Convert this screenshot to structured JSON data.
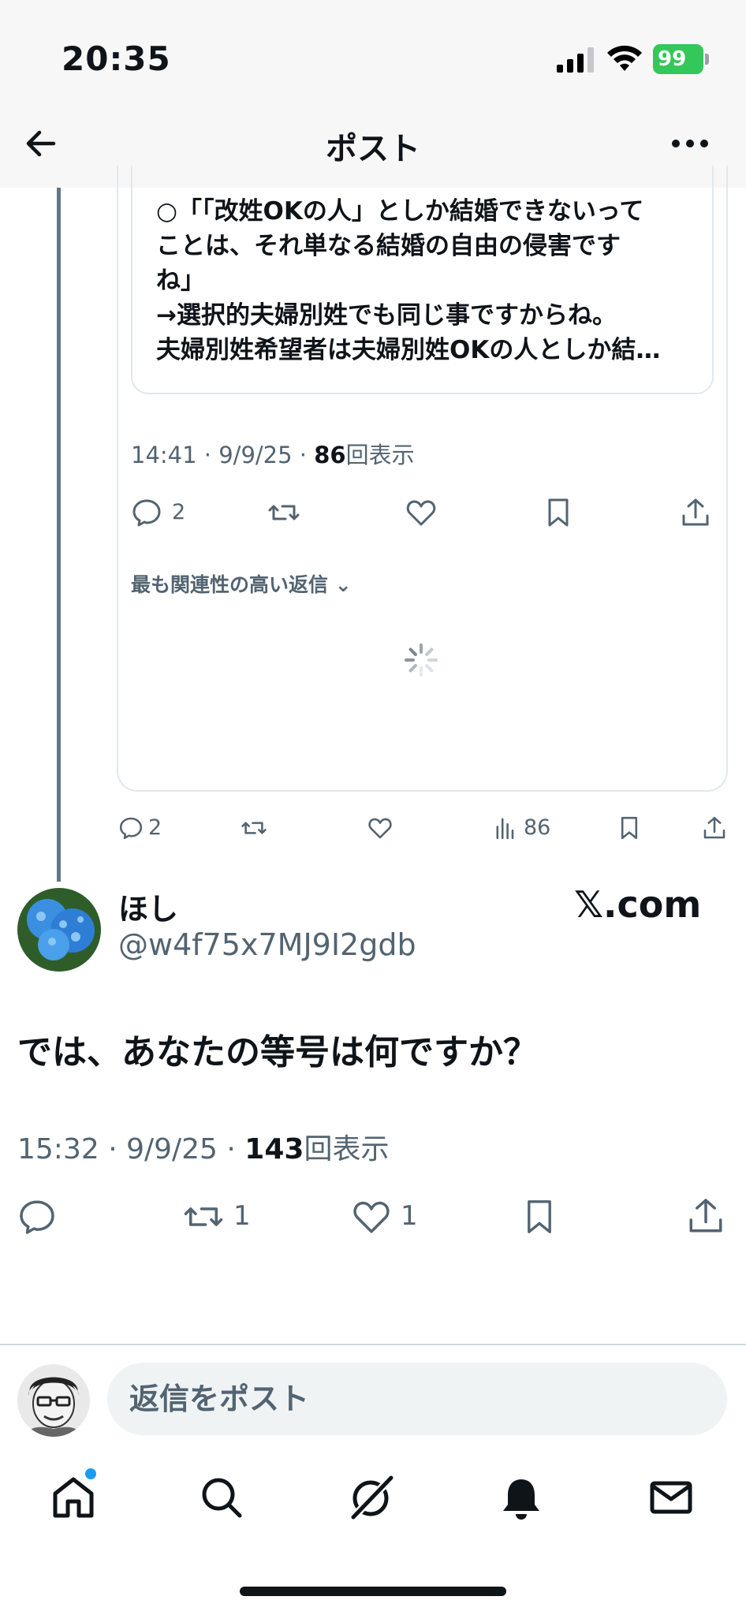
{
  "status_bar": {
    "time": "20:35",
    "battery": "99"
  },
  "header": {
    "title": "ポスト"
  },
  "quoted": {
    "text": "○「「改姓OKの人」としか結婚できないって\nことは、それ単なる結婚の自由の侵害です\nね」\n→選択的夫婦別姓でも同じ事ですからね。\n夫婦別姓希望者は夫婦別姓OKの人としか結…",
    "time": "14:41 · 9/9/25 · ",
    "views": "86",
    "views_label": "回表示",
    "reply_count": "2",
    "sort_label": "最も関連性の高い返信"
  },
  "parent_actions": {
    "reply_count": "2",
    "views": "86"
  },
  "post": {
    "display_name": "ほし",
    "handle": "@w4f75x7MJ9I2gdb",
    "watermark": "𝕏.com",
    "text": "では、あなたの等号は何ですか？",
    "time": "15:32 · 9/9/25 · ",
    "views": "143",
    "views_label": "回表示",
    "retweet_count": "1",
    "like_count": "1"
  },
  "composer": {
    "placeholder": "返信をポスト"
  },
  "colors": {
    "accent": "#1d9bf0",
    "battery": "#34c759",
    "text": "#0f1419",
    "muted": "#536471"
  }
}
